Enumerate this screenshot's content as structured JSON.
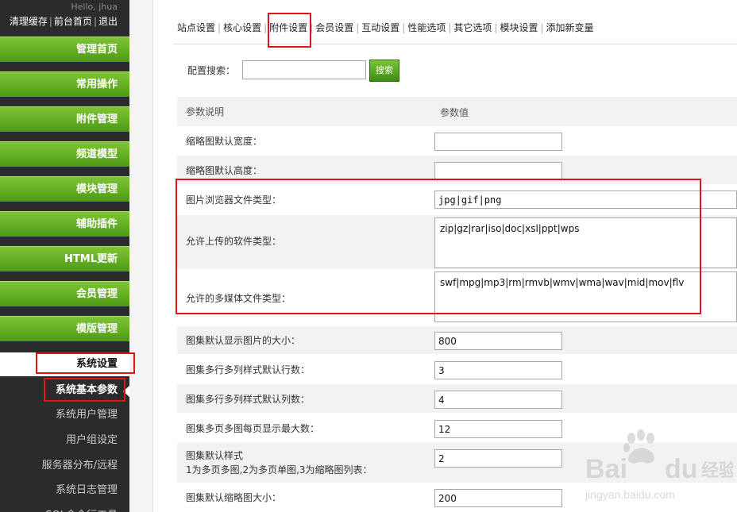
{
  "sidebar": {
    "hello": "Hello, jhua",
    "top_links": [
      "清理缓存",
      "前台首页",
      "退出"
    ],
    "menu": [
      {
        "label": "管理首页"
      },
      {
        "label": "常用操作"
      },
      {
        "label": "附件管理"
      },
      {
        "label": "频道模型"
      },
      {
        "label": "模块管理"
      },
      {
        "label": "辅助插件"
      },
      {
        "label": "HTML更新"
      },
      {
        "label": "会员管理"
      },
      {
        "label": "模版管理"
      },
      {
        "label": "系统设置"
      }
    ],
    "sub_menu": [
      {
        "label": "系统基本参数"
      },
      {
        "label": "系统用户管理"
      },
      {
        "label": "用户组设定"
      },
      {
        "label": "服务器分布/远程"
      },
      {
        "label": "系统日志管理"
      },
      {
        "label": "SQL命令行工具"
      }
    ]
  },
  "tabs": [
    "站点设置",
    "核心设置",
    "附件设置",
    "会员设置",
    "互动设置",
    "性能选项",
    "其它选项",
    "模块设置",
    "添加新变量"
  ],
  "search": {
    "label": "配置搜索：",
    "value": "",
    "button": "搜索"
  },
  "table": {
    "header": {
      "desc": "参数说明",
      "value": "参数值"
    },
    "rows": [
      {
        "label": "缩略图默认宽度：",
        "value": ""
      },
      {
        "label": "缩略图默认高度：",
        "value": ""
      },
      {
        "label": "图片浏览器文件类型：",
        "value": "jpg|gif|png"
      },
      {
        "label": "允许上传的软件类型：",
        "value": "zip|gz|rar|iso|doc|xsl|ppt|wps"
      },
      {
        "label": "允许的多媒体文件类型：",
        "value": "swf|mpg|mp3|rm|rmvb|wmv|wma|wav|mid|mov|flv"
      },
      {
        "label": "图集默认显示图片的大小：",
        "value": "800"
      },
      {
        "label": "图集多行多列样式默认行数：",
        "value": "3"
      },
      {
        "label": "图集多行多列样式默认列数：",
        "value": "4"
      },
      {
        "label": "图集多页多图每页显示最大数：",
        "value": "12"
      },
      {
        "label": "图集默认样式",
        "label2": "1为多页多图,2为多页单图,3为缩略图列表：",
        "value": "2"
      },
      {
        "label": "图集默认缩略图大小：",
        "value": "200"
      }
    ]
  },
  "watermark": {
    "brand": "Bai",
    "brand2": "du",
    "cn": "经验",
    "url": "jingyan.baidu.com"
  },
  "colors": {
    "accent_green": "#4e9a14",
    "highlight_red": "#e3121a",
    "sidebar_bg": "#2b2b2b"
  }
}
